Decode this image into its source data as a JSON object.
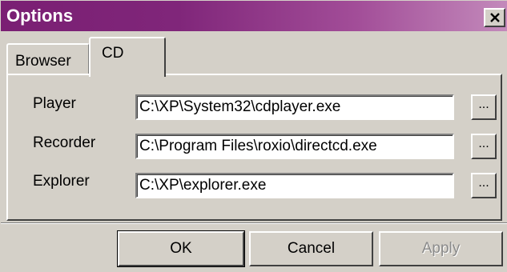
{
  "window": {
    "title": "Options",
    "close_symbol": "close-icon",
    "title_bar_color": "#7a1f73"
  },
  "tabs": [
    {
      "label": "Browser",
      "selected": false
    },
    {
      "label": "CD",
      "selected": true
    }
  ],
  "rows": [
    {
      "label": "Player",
      "value": "C:\\XP\\System32\\cdplayer.exe",
      "browse_label": "..."
    },
    {
      "label": "Recorder",
      "value": "C:\\Program Files\\roxio\\directcd.exe",
      "browse_label": "..."
    },
    {
      "label": "Explorer",
      "value": "C:\\XP\\explorer.exe",
      "browse_label": "..."
    }
  ],
  "buttons": {
    "ok": "OK",
    "cancel": "Cancel",
    "apply": "Apply",
    "apply_enabled": false
  }
}
